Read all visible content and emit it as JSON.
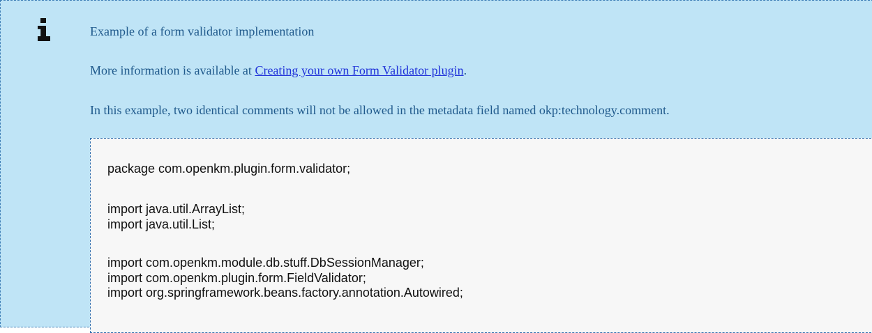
{
  "info": {
    "icon": "info-icon",
    "title": "Example of a form validator implementation",
    "more_prefix": "More information is available at ",
    "more_link": "Creating your own Form Validator plugin",
    "more_suffix": ".",
    "description": "In this example, two identical comments will not be allowed in the metadata field named okp:technology.comment."
  },
  "code": {
    "lines": [
      "package com.openkm.plugin.form.validator;",
      "import java.util.ArrayList;",
      "import java.util.List;",
      "import com.openkm.module.db.stuff.DbSessionManager;",
      "import com.openkm.plugin.form.FieldValidator;",
      "import org.springframework.beans.factory.annotation.Autowired;"
    ]
  },
  "colors": {
    "box_background": "#bfe4f6",
    "box_border": "#3f7fb7",
    "text": "#205a8c",
    "link": "#1f31d9",
    "code_background": "#f7f7f7"
  }
}
